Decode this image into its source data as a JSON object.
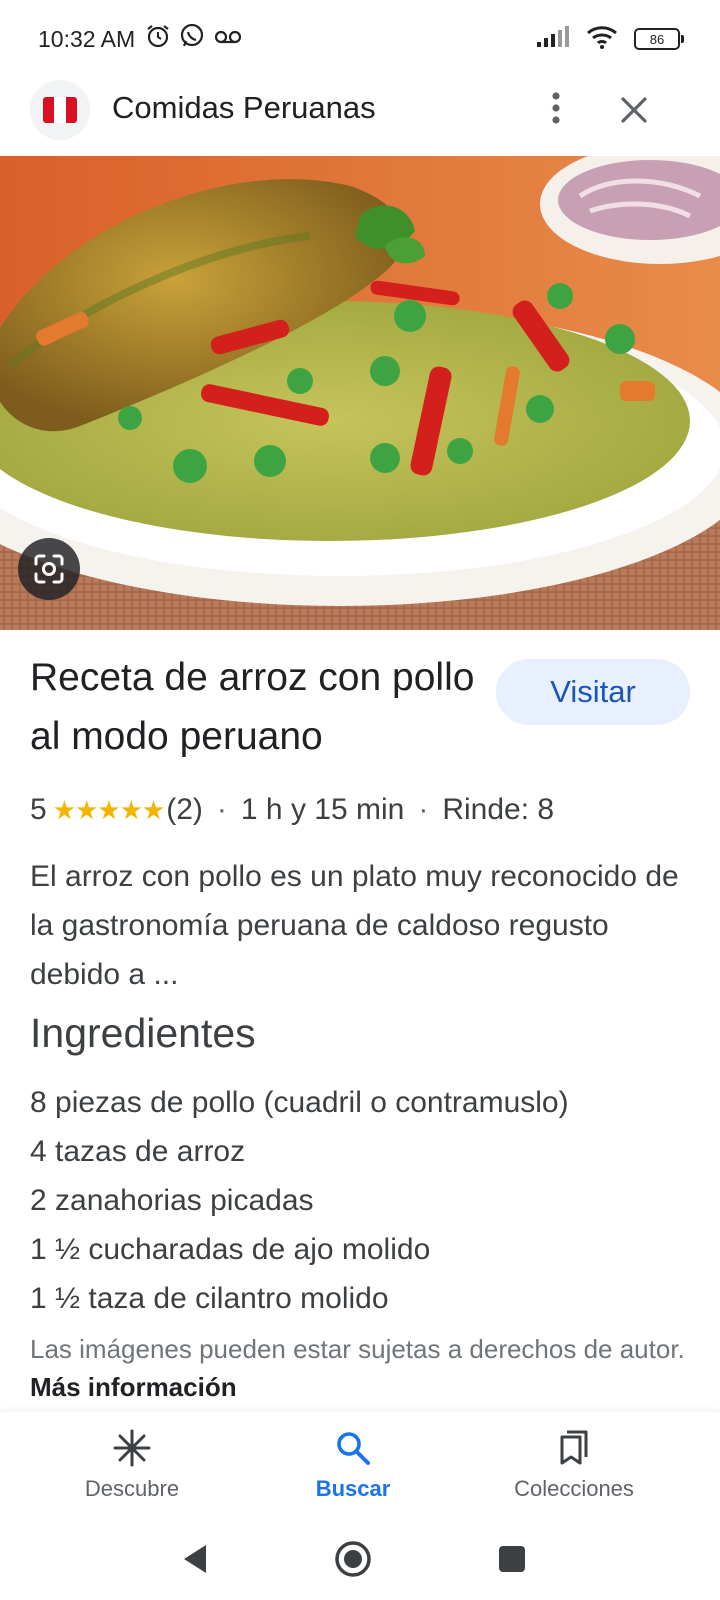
{
  "status_bar": {
    "time": "10:32 AM",
    "battery": "86",
    "icons": [
      "alarm-icon",
      "whatsapp-icon",
      "voicemail-icon",
      "signal-icon",
      "wifi-icon",
      "battery-icon"
    ]
  },
  "header": {
    "title": "Comidas Peruanas",
    "logo_icon": "peru-flag-icon",
    "menu_icon": "more-vert-icon",
    "close_icon": "close-icon"
  },
  "hero": {
    "lens_icon": "google-lens-icon"
  },
  "recipe": {
    "title": "Receta de arroz con pollo al modo peruano",
    "visit_label": "Visitar",
    "rating": "5",
    "stars": "★★★★★",
    "reviews": "(2)",
    "time": "1 h y 15 min",
    "yield": "Rinde: 8",
    "description": "El arroz con pollo es un plato muy reconocido de la gastronomía peruana de caldoso regusto debido a ...",
    "ingredients_heading": "Ingredientes",
    "ingredients": [
      "8 piezas de pollo (cuadril o contramuslo)",
      "4 tazas de arroz",
      "2 zanahorias picadas",
      "1 ½ cucharadas de ajo molido",
      "1 ½ taza de cilantro molido"
    ],
    "copyright_text": "Las imágenes pueden estar sujetas a derechos de autor.",
    "more_info": "Más información"
  },
  "bottom_nav": {
    "items": [
      {
        "label": "Descubre",
        "icon": "asterisk-icon",
        "active": false
      },
      {
        "label": "Buscar",
        "icon": "search-icon",
        "active": true
      },
      {
        "label": "Colecciones",
        "icon": "bookmarks-icon",
        "active": false
      }
    ]
  },
  "colors": {
    "accent": "#1a73e8",
    "visit_bg": "#e8f0fe",
    "star": "#f4b400"
  }
}
